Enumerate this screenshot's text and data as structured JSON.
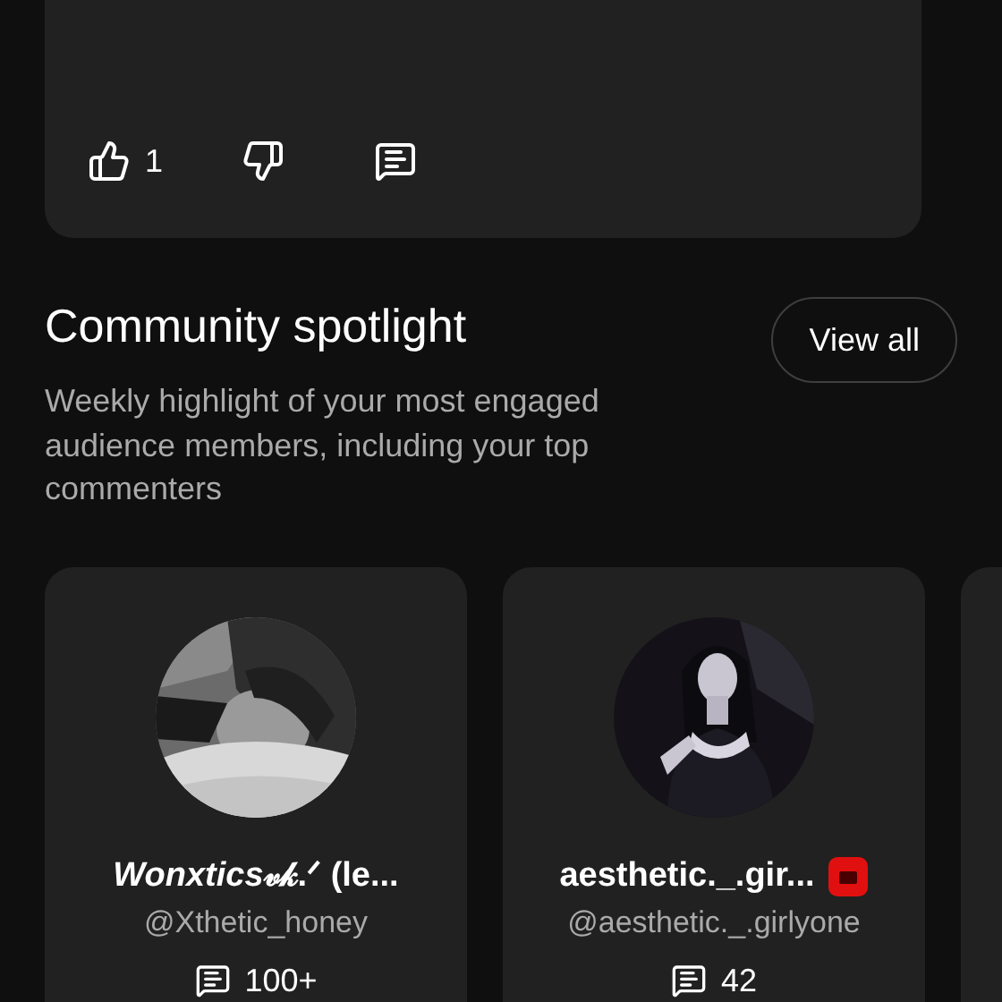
{
  "post": {
    "likes": "1"
  },
  "spotlight": {
    "title": "Community spotlight",
    "description": "Weekly highlight of your most engaged audience members, including your top commenters",
    "view_all": "View all"
  },
  "members": [
    {
      "name": [
        {
          "text": "Wonxtics",
          "italic": true
        },
        {
          "text": "𝓋𝓀.ᐟ (le...",
          "italic": false
        }
      ],
      "handle": "@Xthetic_honey",
      "comments": "100+",
      "badge": false
    },
    {
      "name": [
        {
          "text": "aesthetic._.gir...",
          "italic": false
        }
      ],
      "handle": "@aesthetic._.girlyone",
      "comments": "42",
      "badge": true
    }
  ]
}
